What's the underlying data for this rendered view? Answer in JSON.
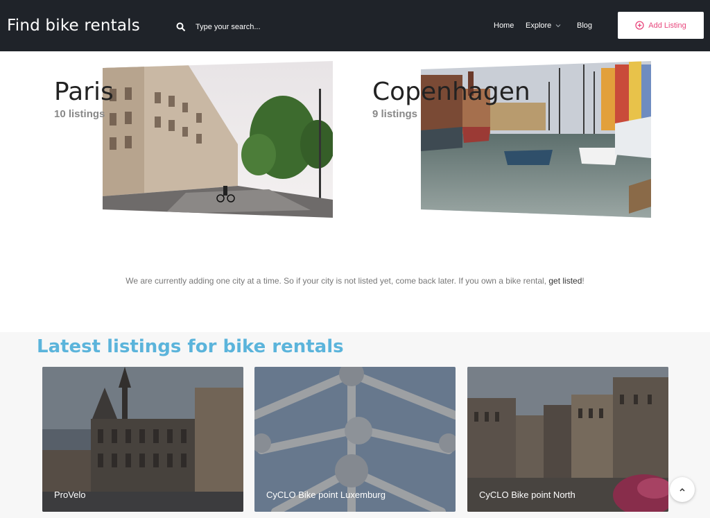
{
  "header": {
    "brand": "Find bike rentals",
    "search_placeholder": "Type your search...",
    "nav": {
      "home": "Home",
      "explore": "Explore",
      "blog": "Blog"
    },
    "add_listing": "Add Listing"
  },
  "cities": [
    {
      "name": "Paris",
      "count": "10 listings"
    },
    {
      "name": "Copenhagen",
      "count": "9 listings"
    }
  ],
  "notice": {
    "text": "We are currently adding one city at a time. So if your city is not listed yet, come back later. If you own a bike rental, ",
    "link": "get listed",
    "suffix": "!"
  },
  "latest": {
    "title": "Latest listings for bike rentals",
    "cards": [
      {
        "label": "ProVelo"
      },
      {
        "label": "CyCLO Bike point Luxemburg"
      },
      {
        "label": "CyCLO Bike point North"
      }
    ]
  },
  "colors": {
    "header_bg": "#1f2329",
    "accent": "#e8467c",
    "title_blue": "#5bb4db"
  }
}
